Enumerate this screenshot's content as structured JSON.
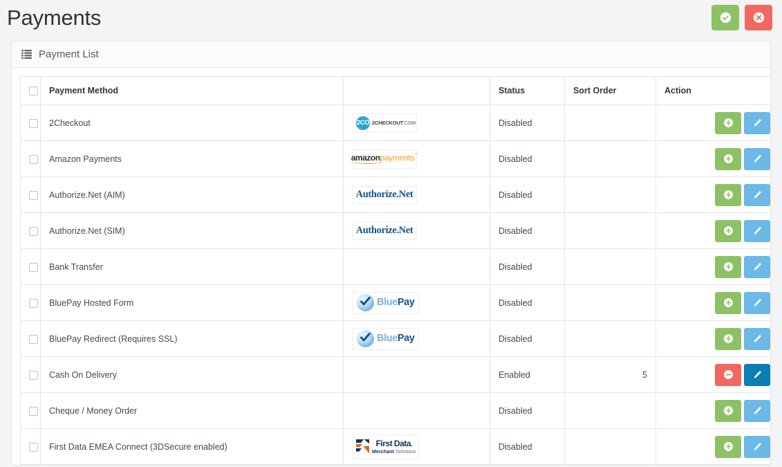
{
  "header": {
    "title": "Payments",
    "actions": [
      {
        "name": "save-button",
        "icon": "check-circle-icon",
        "color": "#8cc265",
        "style": "green"
      },
      {
        "name": "cancel-button",
        "icon": "times-circle-icon",
        "color": "#f2675f",
        "style": "red"
      }
    ]
  },
  "panel": {
    "icon": "list-icon",
    "title": "Payment List"
  },
  "table": {
    "columns": [
      {
        "key": "select",
        "label": "",
        "align": "center"
      },
      {
        "key": "method",
        "label": "Payment Method",
        "align": "left"
      },
      {
        "key": "logo",
        "label": "",
        "align": "center"
      },
      {
        "key": "status",
        "label": "Status",
        "align": "left"
      },
      {
        "key": "sort",
        "label": "Sort Order",
        "align": "right"
      },
      {
        "key": "action",
        "label": "Action",
        "align": "right"
      }
    ],
    "select_all_checkbox": false,
    "rows": [
      {
        "method": "2Checkout",
        "logo": "2checkout",
        "status": "Disabled",
        "sort": "",
        "toggle": "enable",
        "toggle_icon": "plus-circle-icon",
        "edit_icon": "pencil-icon",
        "edit_state": "normal"
      },
      {
        "method": "Amazon Payments",
        "logo": "amazon",
        "status": "Disabled",
        "sort": "",
        "toggle": "enable",
        "toggle_icon": "plus-circle-icon",
        "edit_icon": "pencil-icon",
        "edit_state": "normal"
      },
      {
        "method": "Authorize.Net (AIM)",
        "logo": "authorizenet",
        "status": "Disabled",
        "sort": "",
        "toggle": "enable",
        "toggle_icon": "plus-circle-icon",
        "edit_icon": "pencil-icon",
        "edit_state": "normal"
      },
      {
        "method": "Authorize.Net (SIM)",
        "logo": "authorizenet",
        "status": "Disabled",
        "sort": "",
        "toggle": "enable",
        "toggle_icon": "plus-circle-icon",
        "edit_icon": "pencil-icon",
        "edit_state": "normal"
      },
      {
        "method": "Bank Transfer",
        "logo": "",
        "status": "Disabled",
        "sort": "",
        "toggle": "enable",
        "toggle_icon": "plus-circle-icon",
        "edit_icon": "pencil-icon",
        "edit_state": "normal"
      },
      {
        "method": "BluePay Hosted Form",
        "logo": "bluepay",
        "status": "Disabled",
        "sort": "",
        "toggle": "enable",
        "toggle_icon": "plus-circle-icon",
        "edit_icon": "pencil-icon",
        "edit_state": "normal"
      },
      {
        "method": "BluePay Redirect (Requires SSL)",
        "logo": "bluepay",
        "status": "Disabled",
        "sort": "",
        "toggle": "enable",
        "toggle_icon": "plus-circle-icon",
        "edit_icon": "pencil-icon",
        "edit_state": "normal"
      },
      {
        "method": "Cash On Delivery",
        "logo": "",
        "status": "Enabled",
        "sort": "5",
        "toggle": "disable",
        "toggle_icon": "minus-circle-icon",
        "edit_icon": "pencil-icon",
        "edit_state": "active"
      },
      {
        "method": "Cheque / Money Order",
        "logo": "",
        "status": "Disabled",
        "sort": "",
        "toggle": "enable",
        "toggle_icon": "plus-circle-icon",
        "edit_icon": "pencil-icon",
        "edit_state": "normal"
      },
      {
        "method": "First Data EMEA Connect (3DSecure enabled)",
        "logo": "firstdata",
        "status": "Disabled",
        "sort": "",
        "toggle": "enable",
        "toggle_icon": "plus-circle-icon",
        "edit_icon": "pencil-icon",
        "edit_state": "normal"
      }
    ]
  },
  "logos": {
    "2checkout": {
      "badge": "2CO",
      "name": "2CHECKOUT",
      "suffix": ".COM"
    },
    "amazon": {
      "part1": "amazon",
      "part2": "payments",
      "mark": "™"
    },
    "authorizenet": {
      "name": "Authorize.Net"
    },
    "bluepay": {
      "part1": "Blue",
      "part2": "Pay"
    },
    "firstdata": {
      "part1": "First Data",
      "dot": ".",
      "part2a": "Merchant",
      "part2b": "Solutions"
    }
  },
  "colors": {
    "page_bg": "#f4f4f4",
    "panel_bg": "#ffffff",
    "border": "#e5e5e5",
    "green": "#8cc265",
    "red": "#f2675f",
    "blue": "#6cb8e6",
    "blue_active": "#0b7eb4",
    "text": "#44494e"
  }
}
